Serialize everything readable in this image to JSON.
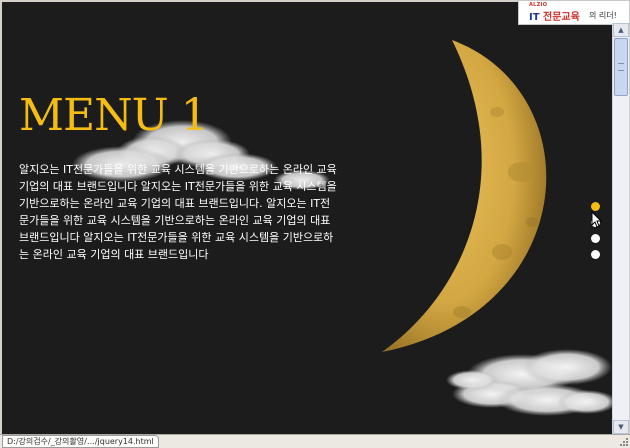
{
  "logo": {
    "brand": "ALZIO",
    "title_it": "IT",
    "title_main": "전문교육",
    "subtitle": "의 리더!"
  },
  "menu": {
    "title": "MENU 1",
    "description": "알지오는 IT전문가들을 위한 교육 시스템을 기반으로하는 온라인 교육 기업의 대표 브랜드입니다 알지오는 IT전문가들을 위한 교육 시스템을 기반으로하는 온라인 교육 기업의 대표 브랜드입니다. 알지오는 IT전문가들을 위한 교육 시스템을 기반으로하는 온라인 교육 기업의 대표 브랜드입니다 알지오는 IT전문가들을 위한 교육 시스템을 기반으로하는 온라인 교육 기업의 대표 브랜드입니다"
  },
  "pagination": {
    "count": 4,
    "active_index": 0
  },
  "status_bar": {
    "path": "D:/강의검수/_강의촬영/…/jquery14.html"
  },
  "colors": {
    "background": "#1c1c1d",
    "accent_gold": "#f5bd12",
    "text": "#ffffff",
    "logo_blue": "#1d3a8a",
    "logo_red": "#d0302a"
  },
  "icons": {
    "scroll_up": "up-arrow-icon",
    "scroll_down": "down-arrow-icon",
    "cursor": "mouse-pointer-icon",
    "grip": "resize-grip-icon"
  }
}
